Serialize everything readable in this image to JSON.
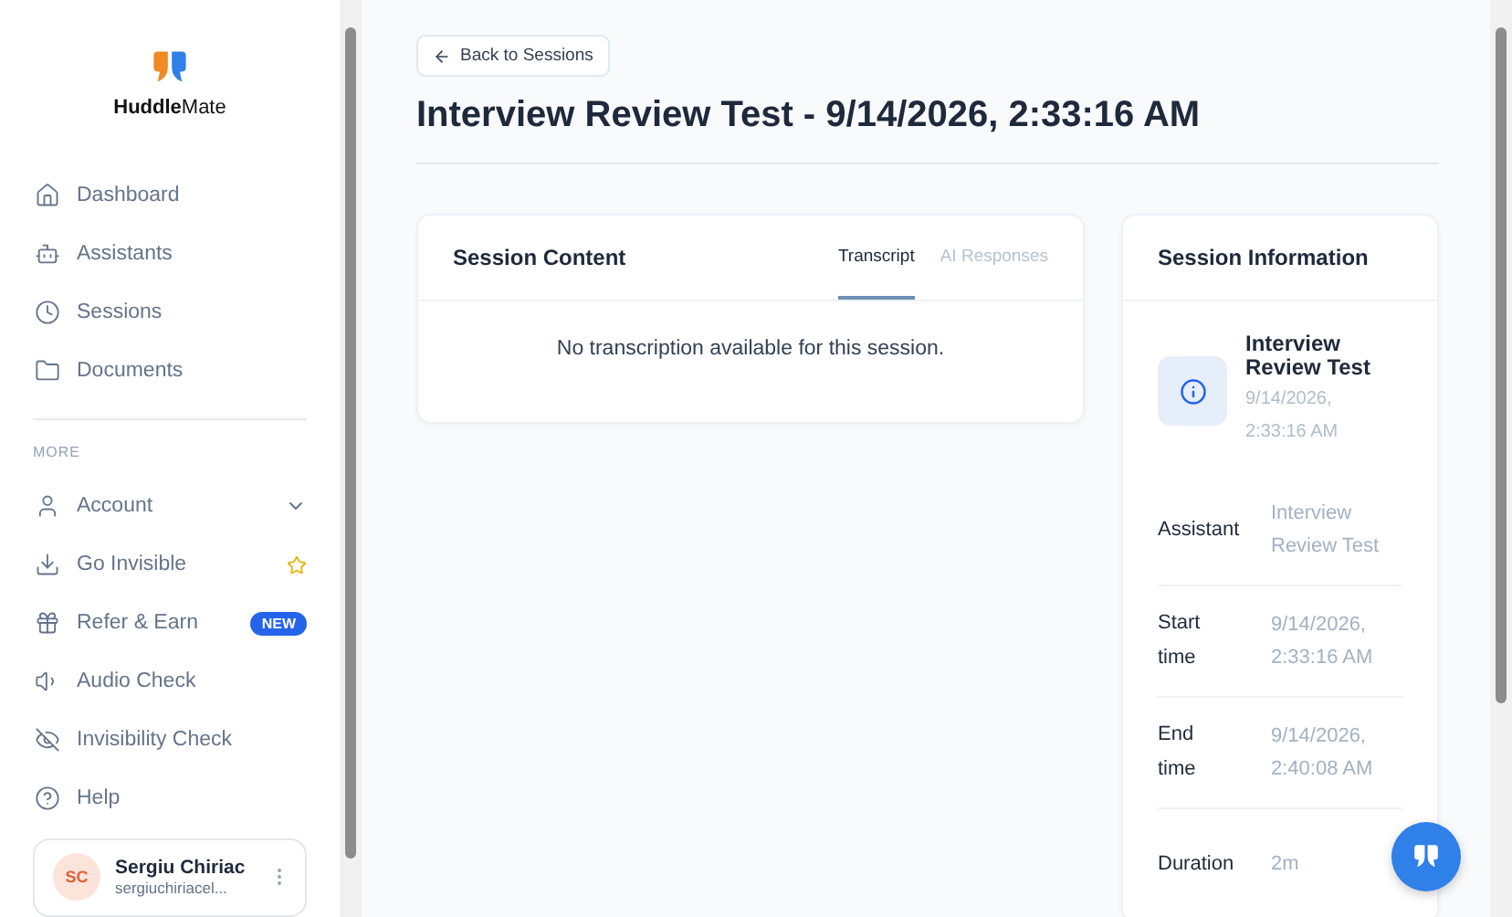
{
  "brand": {
    "name_bold": "Huddle",
    "name_light": "Mate"
  },
  "nav": [
    {
      "label": "Dashboard"
    },
    {
      "label": "Assistants"
    },
    {
      "label": "Sessions"
    },
    {
      "label": "Documents"
    }
  ],
  "more_heading": "MORE",
  "more": [
    {
      "label": "Account",
      "kind": "expand",
      "expanded": false
    },
    {
      "label": "Go Invisible",
      "kind": "star"
    },
    {
      "label": "Refer & Earn",
      "kind": "badge",
      "badge": "NEW"
    },
    {
      "label": "Audio Check",
      "kind": "plain"
    },
    {
      "label": "Invisibility Check",
      "kind": "plain"
    },
    {
      "label": "Help",
      "kind": "plain"
    }
  ],
  "user": {
    "initials": "SC",
    "name": "Sergiu Chiriac",
    "email": "sergiuchiriacel..."
  },
  "back_button": "Back to Sessions",
  "title": "Interview Review Test - 9/14/2026, 2:33:16 AM",
  "content_card": {
    "title": "Session Content",
    "tabs": [
      {
        "label": "Transcript",
        "selected": true
      },
      {
        "label": "AI Responses",
        "selected": false
      }
    ],
    "empty_message": "No transcription available for this session."
  },
  "info_card": {
    "title": "Session Information",
    "summary": {
      "name": "Interview Review Test",
      "date": "9/14/2026, 2:33:16 AM"
    },
    "rows": [
      {
        "label": "Assistant",
        "value": "Interview Review Test"
      },
      {
        "label": "Start time",
        "value": "9/14/2026, 2:33:16 AM"
      },
      {
        "label": "End time",
        "value": "9/14/2026, 2:40:08 AM"
      },
      {
        "label": "Duration",
        "value": "2m"
      }
    ]
  }
}
